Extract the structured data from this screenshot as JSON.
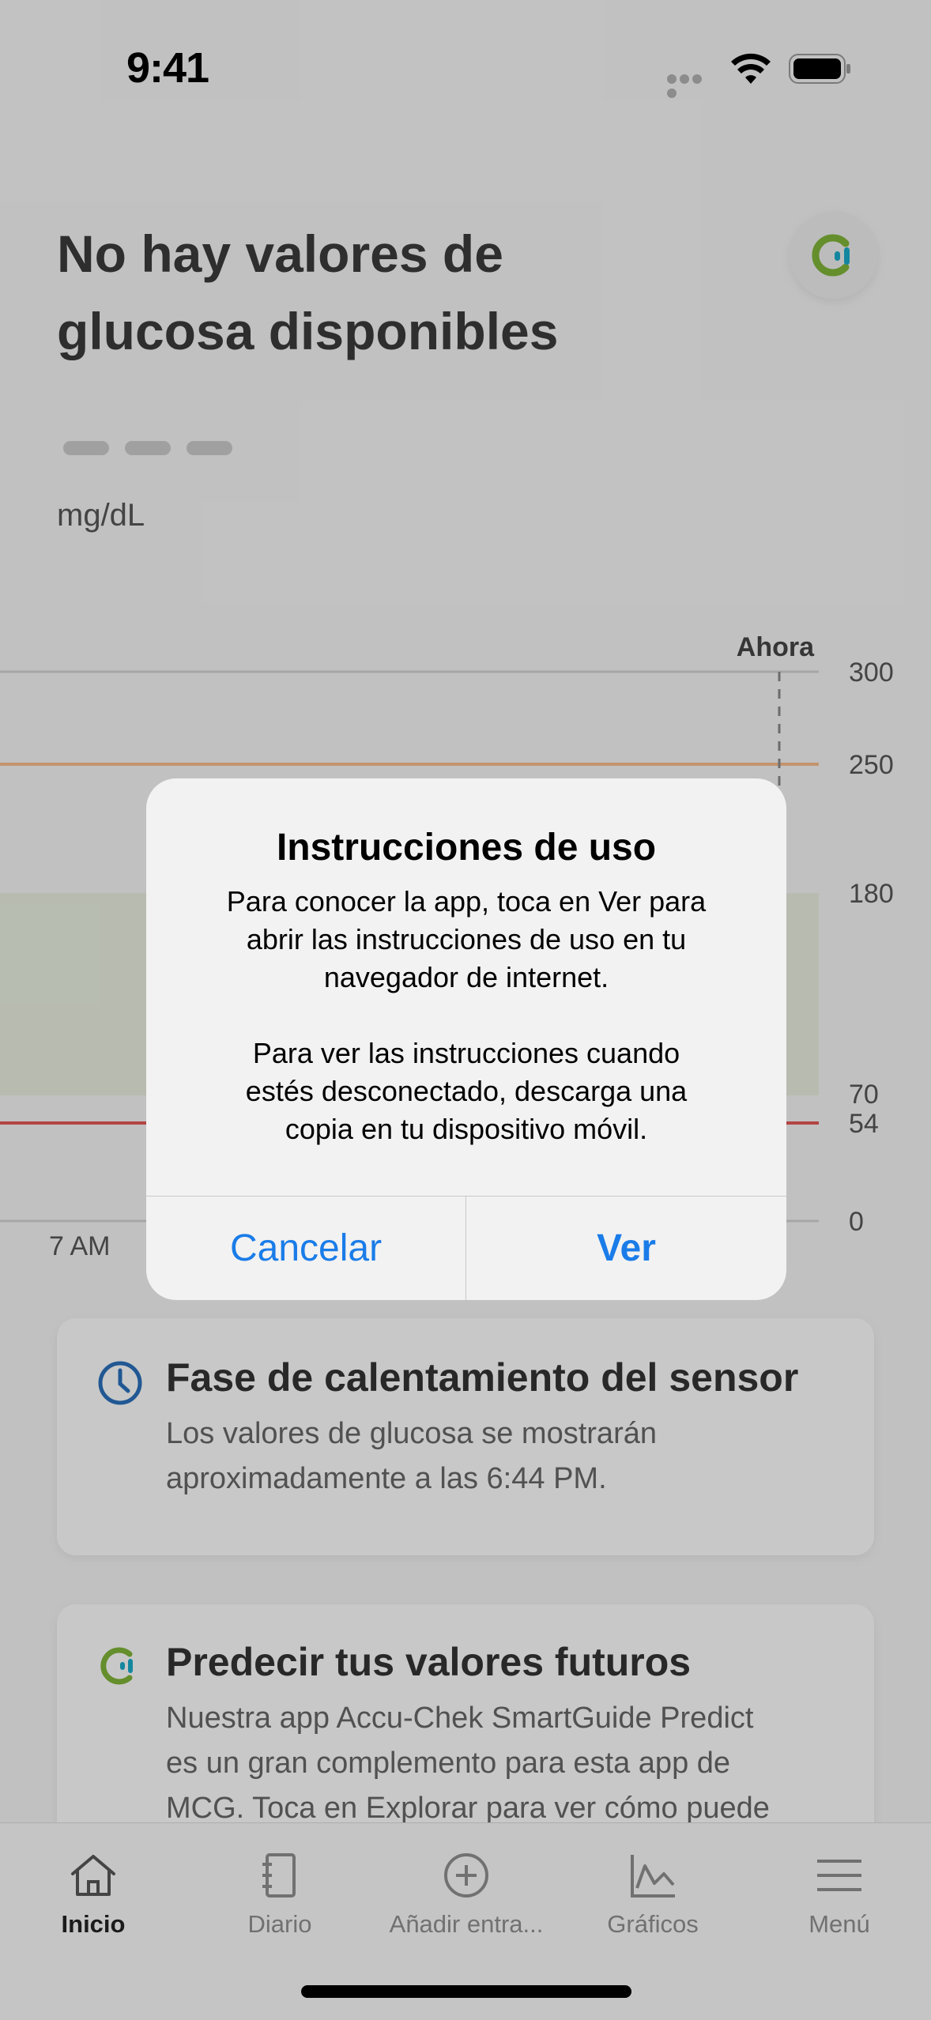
{
  "status_bar": {
    "time": "9:41"
  },
  "header": {
    "title_line1": "No hay valores de",
    "title_line2": "glucosa disponibles",
    "unit": "mg/dL",
    "logo_icon": "smartguide-logo-icon"
  },
  "chart": {
    "now_label": "Ahora",
    "time_label": "7 AM",
    "y_ticks": [
      "300",
      "250",
      "180",
      "70",
      "54",
      "0"
    ],
    "colors": {
      "high": "#f3b98a",
      "low": "#e05656",
      "target_band": "#e6ecdd",
      "grid": "#d0d0d0"
    }
  },
  "cards": [
    {
      "icon": "clock-icon",
      "title": "Fase de calentamiento del sensor",
      "body_line1": "Los valores de glucosa se mostrarán",
      "body_line2": "aproximadamente a las 6:44 PM."
    },
    {
      "icon": "smartguide-predict-icon",
      "title": "Predecir tus valores futuros",
      "body_line1": "Nuestra app Accu-Chek SmartGuide Predict",
      "body_line2": "es un gran complemento para esta app de",
      "body_line3": "MCG. Toca en Explorar para ver cómo puede"
    }
  ],
  "tabs": [
    {
      "label": "Inicio",
      "icon": "home-icon",
      "active": true
    },
    {
      "label": "Diario",
      "icon": "diary-icon",
      "active": false
    },
    {
      "label": "Añadir entra...",
      "icon": "add-circle-icon",
      "active": false
    },
    {
      "label": "Gráficos",
      "icon": "chart-icon",
      "active": false
    },
    {
      "label": "Menú",
      "icon": "menu-icon",
      "active": false
    }
  ],
  "dialog": {
    "title": "Instrucciones de uso",
    "message_line1": "Para conocer la app, toca en Ver para",
    "message_line2": "abrir las instrucciones de uso en tu",
    "message_line3": "navegador de internet.",
    "message2_line1": "Para ver las instrucciones cuando",
    "message2_line2": "estés desconectado, descarga una",
    "message2_line3": "copia en tu dispositivo móvil.",
    "cancel_label": "Cancelar",
    "confirm_label": "Ver"
  }
}
